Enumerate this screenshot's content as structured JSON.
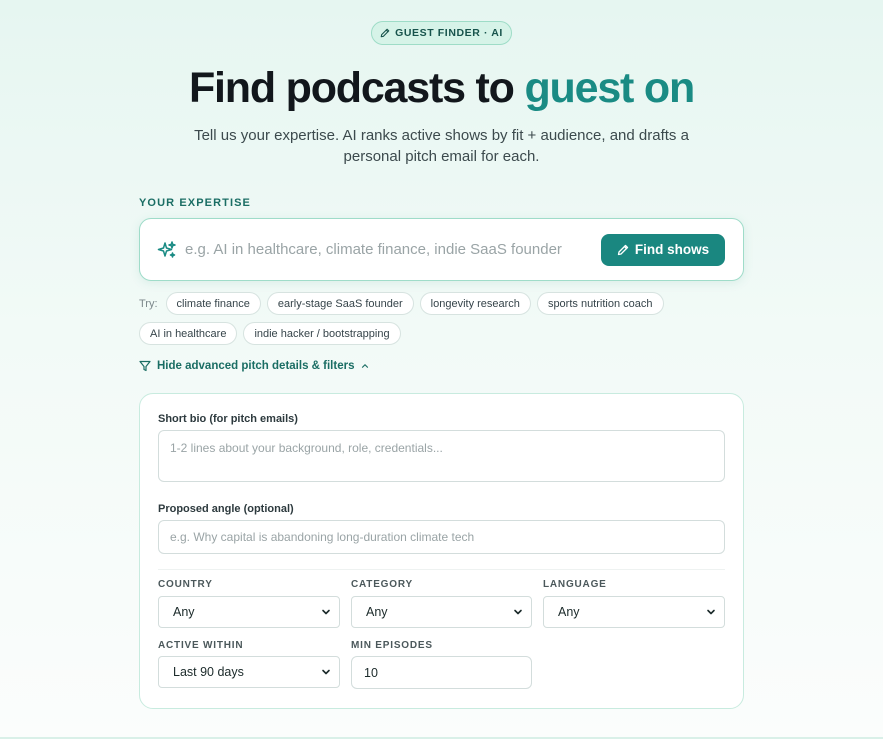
{
  "badge": {
    "label": "GUEST FINDER · AI",
    "icon": "pencil-icon"
  },
  "hero": {
    "title_main": "Find podcasts to ",
    "title_accent": "guest on",
    "subtitle": "Tell us your expertise. AI ranks active shows by fit + audience, and drafts a personal pitch email for each."
  },
  "search": {
    "section_label": "YOUR EXPERTISE",
    "placeholder": "e.g. AI in healthcare, climate finance, indie SaaS founder",
    "value": "",
    "button_label": "Find shows",
    "icon": "sparkles-icon"
  },
  "suggestions": {
    "label": "Try:",
    "items": [
      "climate finance",
      "early-stage SaaS founder",
      "longevity research",
      "sports nutrition coach",
      "AI in healthcare",
      "indie hacker / bootstrapping"
    ]
  },
  "advanced": {
    "toggle_label": "Hide advanced pitch details & filters",
    "bio_label": "Short bio (for pitch emails)",
    "bio_placeholder": "1-2 lines about your background, role, credentials...",
    "angle_label": "Proposed angle (optional)",
    "angle_placeholder": "e.g. Why capital is abandoning long-duration climate tech",
    "filters": {
      "country_label": "COUNTRY",
      "country_value": "Any",
      "category_label": "CATEGORY",
      "category_value": "Any",
      "language_label": "LANGUAGE",
      "language_value": "Any",
      "active_label": "ACTIVE WITHIN",
      "active_value": "Last 90 days",
      "min_episodes_label": "MIN EPISODES",
      "min_episodes_value": "10"
    }
  },
  "colors": {
    "accent": "#1a8b84",
    "button": "#1a8780",
    "border": "#9fdcc9"
  }
}
